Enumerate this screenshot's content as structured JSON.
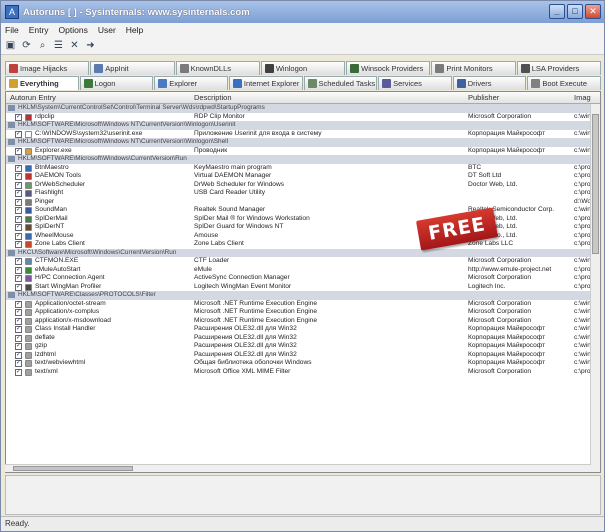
{
  "window": {
    "title": "Autoruns [  ] - Sysinternals: www.sysinternals.com"
  },
  "menu": [
    "File",
    "Entry",
    "Options",
    "User",
    "Help"
  ],
  "toolbar_icons": [
    "save-icon",
    "refresh-icon",
    "find-icon",
    "properties-icon",
    "delete-icon",
    "jump-icon"
  ],
  "tabs_row1": [
    {
      "label": "Image Hijacks",
      "color": "#c04040"
    },
    {
      "label": "AppInit",
      "color": "#5a7ab0"
    },
    {
      "label": "KnownDLLs",
      "color": "#7a7a7a"
    },
    {
      "label": "Winlogon",
      "color": "#404040"
    },
    {
      "label": "Winsock Providers",
      "color": "#3a6a3a"
    },
    {
      "label": "Print Monitors",
      "color": "#7a7a7a"
    },
    {
      "label": "LSA Providers",
      "color": "#505050"
    }
  ],
  "tabs_row2": [
    {
      "label": "Everything",
      "color": "#d0a030"
    },
    {
      "label": "Logon",
      "color": "#3a7a3a"
    },
    {
      "label": "Explorer",
      "color": "#4a7ac0"
    },
    {
      "label": "Internet Explorer",
      "color": "#3a70c0"
    },
    {
      "label": "Scheduled Tasks",
      "color": "#6a8a6a"
    },
    {
      "label": "Services",
      "color": "#5a5a9a"
    },
    {
      "label": "Drivers",
      "color": "#4060a0"
    },
    {
      "label": "Boot Execute",
      "color": "#808080"
    }
  ],
  "columns": {
    "entry": "Autorun Entry",
    "description": "Description",
    "publisher": "Publisher",
    "image": "Imag"
  },
  "rows": [
    {
      "type": "group",
      "text": "HKLM\\System\\CurrentControlSet\\Control\\Terminal Server\\Wds\\rdpwd\\StartupPrograms"
    },
    {
      "type": "entry",
      "checked": true,
      "color": "#c03030",
      "name": "rdpclip",
      "desc": "RDP Clip Monitor",
      "pub": "Microsoft Corporation",
      "img": "c:\\win"
    },
    {
      "type": "group",
      "text": "HKLM\\SOFTWARE\\Microsoft\\Windows NT\\CurrentVersion\\Winlogon\\Userinit"
    },
    {
      "type": "entry",
      "checked": true,
      "color": "#ffffff",
      "name": "C:\\WINDOWS\\system32\\userinit.exe",
      "desc": "Приложение Userinit для входа в систему",
      "pub": "Корпорация Майкрософт",
      "img": "c:\\win"
    },
    {
      "type": "group",
      "text": "HKLM\\SOFTWARE\\Microsoft\\Windows NT\\CurrentVersion\\Winlogon\\Shell"
    },
    {
      "type": "entry",
      "checked": true,
      "color": "#d9a03a",
      "name": "Explorer.exe",
      "desc": "Проводник",
      "pub": "Корпорация Майкрософт",
      "img": "c:\\win"
    },
    {
      "type": "group",
      "text": "HKLM\\SOFTWARE\\Microsoft\\Windows\\CurrentVersion\\Run"
    },
    {
      "type": "entry",
      "checked": true,
      "color": "#3a6ab0",
      "name": "BtnMaestro",
      "desc": "KeyMaestro main program",
      "pub": "BTC",
      "img": "c:\\pro"
    },
    {
      "type": "entry",
      "checked": true,
      "color": "#c03030",
      "name": "DAEMON Tools",
      "desc": "Virtual DAEMON Manager",
      "pub": "DT Soft Ltd",
      "img": "c:\\pro"
    },
    {
      "type": "entry",
      "checked": true,
      "color": "#6a9a6a",
      "name": "DrWebScheduler",
      "desc": "DrWeb Scheduler for Windows",
      "pub": "Doctor Web, Ltd.",
      "img": "c:\\pro"
    },
    {
      "type": "entry",
      "checked": true,
      "color": "#5a5a8a",
      "name": "Flashlight",
      "desc": "USB Card Reader Utility",
      "pub": "",
      "img": "c:\\pro"
    },
    {
      "type": "entry",
      "checked": true,
      "color": "#7a7a7a",
      "name": "Pinger",
      "desc": "",
      "pub": "",
      "img": "d:\\Wo"
    },
    {
      "type": "entry",
      "checked": true,
      "color": "#3a5a9a",
      "name": "SoundMan",
      "desc": "Realtek Sound Manager",
      "pub": "Realtek Semiconductor Corp.",
      "img": "c:\\win"
    },
    {
      "type": "entry",
      "checked": true,
      "color": "#4a7a4a",
      "name": "SpIDerMail",
      "desc": "SpIDer Mail ® for Windows Workstation",
      "pub": "Doctor Web, Ltd.",
      "img": "c:\\pro"
    },
    {
      "type": "entry",
      "checked": true,
      "color": "#6a4a2a",
      "name": "SpIDerNT",
      "desc": "SpIDer Guard for Windows NT",
      "pub": "Doctor Web, Ltd.",
      "img": "c:\\pro"
    },
    {
      "type": "entry",
      "checked": true,
      "color": "#3a6aaa",
      "name": "WheelMouse",
      "desc": "Amouse",
      "pub": "Amtech Co., Ltd.",
      "img": "c:\\pro"
    },
    {
      "type": "entry",
      "checked": true,
      "color": "#c04a2a",
      "name": "Zone Labs Client",
      "desc": "Zone Labs Client",
      "pub": "Zone Labs LLC",
      "img": "c:\\pro"
    },
    {
      "type": "group",
      "text": "HKCU\\Software\\Microsoft\\Windows\\CurrentVersion\\Run"
    },
    {
      "type": "entry",
      "checked": true,
      "color": "#5a8ab0",
      "name": "CTFMON.EXE",
      "desc": "CTF Loader",
      "pub": "Microsoft Corporation",
      "img": "c:\\win"
    },
    {
      "type": "entry",
      "checked": true,
      "color": "#3a8a3a",
      "name": "eMuleAutoStart",
      "desc": "eMule",
      "pub": "http://www.emule-project.net",
      "img": "c:\\pro"
    },
    {
      "type": "entry",
      "checked": true,
      "color": "#7a5a9a",
      "name": "H/PC Connection Agent",
      "desc": "ActiveSync Connection Manager",
      "pub": "Microsoft Corporation",
      "img": "c:\\pro"
    },
    {
      "type": "entry",
      "checked": true,
      "color": "#4a4a4a",
      "name": "Start WingMan Profiler",
      "desc": "Logitech WingMan Event Monitor",
      "pub": "Logitech Inc.",
      "img": "c:\\pro"
    },
    {
      "type": "group",
      "text": "HKLM\\SOFTWARE\\Classes\\PROTOCOLS\\Filter"
    },
    {
      "type": "entry",
      "checked": true,
      "color": "#a0a0a0",
      "name": "Application/octet-stream",
      "desc": "Microsoft .NET Runtime Execution Engine",
      "pub": "Microsoft Corporation",
      "img": "c:\\win"
    },
    {
      "type": "entry",
      "checked": true,
      "color": "#a0a0a0",
      "name": "Application/x-complus",
      "desc": "Microsoft .NET Runtime Execution Engine",
      "pub": "Microsoft Corporation",
      "img": "c:\\win"
    },
    {
      "type": "entry",
      "checked": true,
      "color": "#a0a0a0",
      "name": "application/x-msdownload",
      "desc": "Microsoft .NET Runtime Execution Engine",
      "pub": "Microsoft Corporation",
      "img": "c:\\win"
    },
    {
      "type": "entry",
      "checked": true,
      "color": "#a0a0a0",
      "name": "Class Install Handler",
      "desc": "Расширения OLE32.dll для Win32",
      "pub": "Корпорация Майкрософт",
      "img": "c:\\win"
    },
    {
      "type": "entry",
      "checked": true,
      "color": "#a0a0a0",
      "name": "deflate",
      "desc": "Расширения OLE32.dll для Win32",
      "pub": "Корпорация Майкрософт",
      "img": "c:\\win"
    },
    {
      "type": "entry",
      "checked": true,
      "color": "#a0a0a0",
      "name": "gzip",
      "desc": "Расширения OLE32.dll для Win32",
      "pub": "Корпорация Майкрософт",
      "img": "c:\\win"
    },
    {
      "type": "entry",
      "checked": true,
      "color": "#a0a0a0",
      "name": "lzdhtml",
      "desc": "Расширения OLE32.dll для Win32",
      "pub": "Корпорация Майкрософт",
      "img": "c:\\win"
    },
    {
      "type": "entry",
      "checked": true,
      "color": "#a0a0a0",
      "name": "text/webviewhtml",
      "desc": "Общая библиотека оболочки Windows",
      "pub": "Корпорация Майкрософт",
      "img": "c:\\win"
    },
    {
      "type": "entry",
      "checked": true,
      "color": "#a0a0a0",
      "name": "text/xml",
      "desc": "Microsoft Office XML MIME Filter",
      "pub": "Microsoft Corporation",
      "img": "c:\\pro"
    }
  ],
  "badge": {
    "text": "FREE"
  },
  "statusbar": {
    "text": "Ready."
  }
}
